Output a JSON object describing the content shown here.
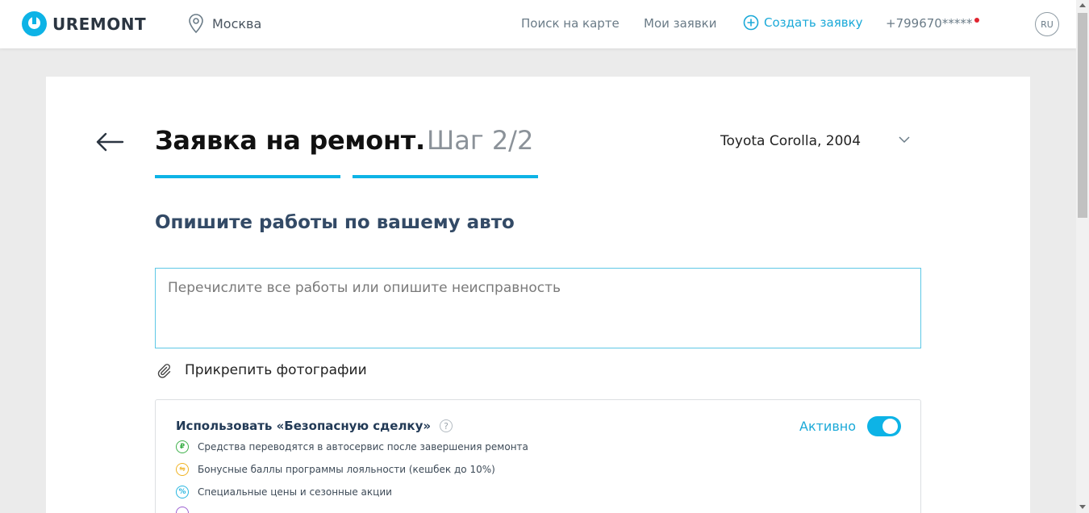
{
  "header": {
    "logo_text": "UREMONT",
    "city": "Москва",
    "nav_map": "Поиск на карте",
    "nav_my": "Мои заявки",
    "nav_create": "Создать заявку",
    "phone": "+799670*****",
    "lang": "RU"
  },
  "form": {
    "title": "Заявка на ремонт.",
    "step": "Шаг 2/2",
    "car": "Toyota Corolla, 2004",
    "subtitle": "Опишите работы по вашему авто",
    "description_placeholder": "Перечислите все работы или опишите неисправность",
    "attach_label": "Прикрепить фотографии"
  },
  "safe_deal": {
    "title": "Использовать «Безопасную сделку»",
    "help": "?",
    "status": "Активно",
    "features": [
      {
        "icon": "ruble-icon",
        "label": "Средства переводятся в автосервис после завершения ремонта"
      },
      {
        "icon": "bonus-icon",
        "label": "Бонусные баллы программы лояльности (кешбек до 10%)"
      },
      {
        "icon": "percent-icon",
        "label": "Специальные цены и сезонные акции"
      }
    ]
  },
  "colors": {
    "accent": "#0db3e6",
    "title_blue": "#334a66",
    "notification": "#e0242f"
  }
}
